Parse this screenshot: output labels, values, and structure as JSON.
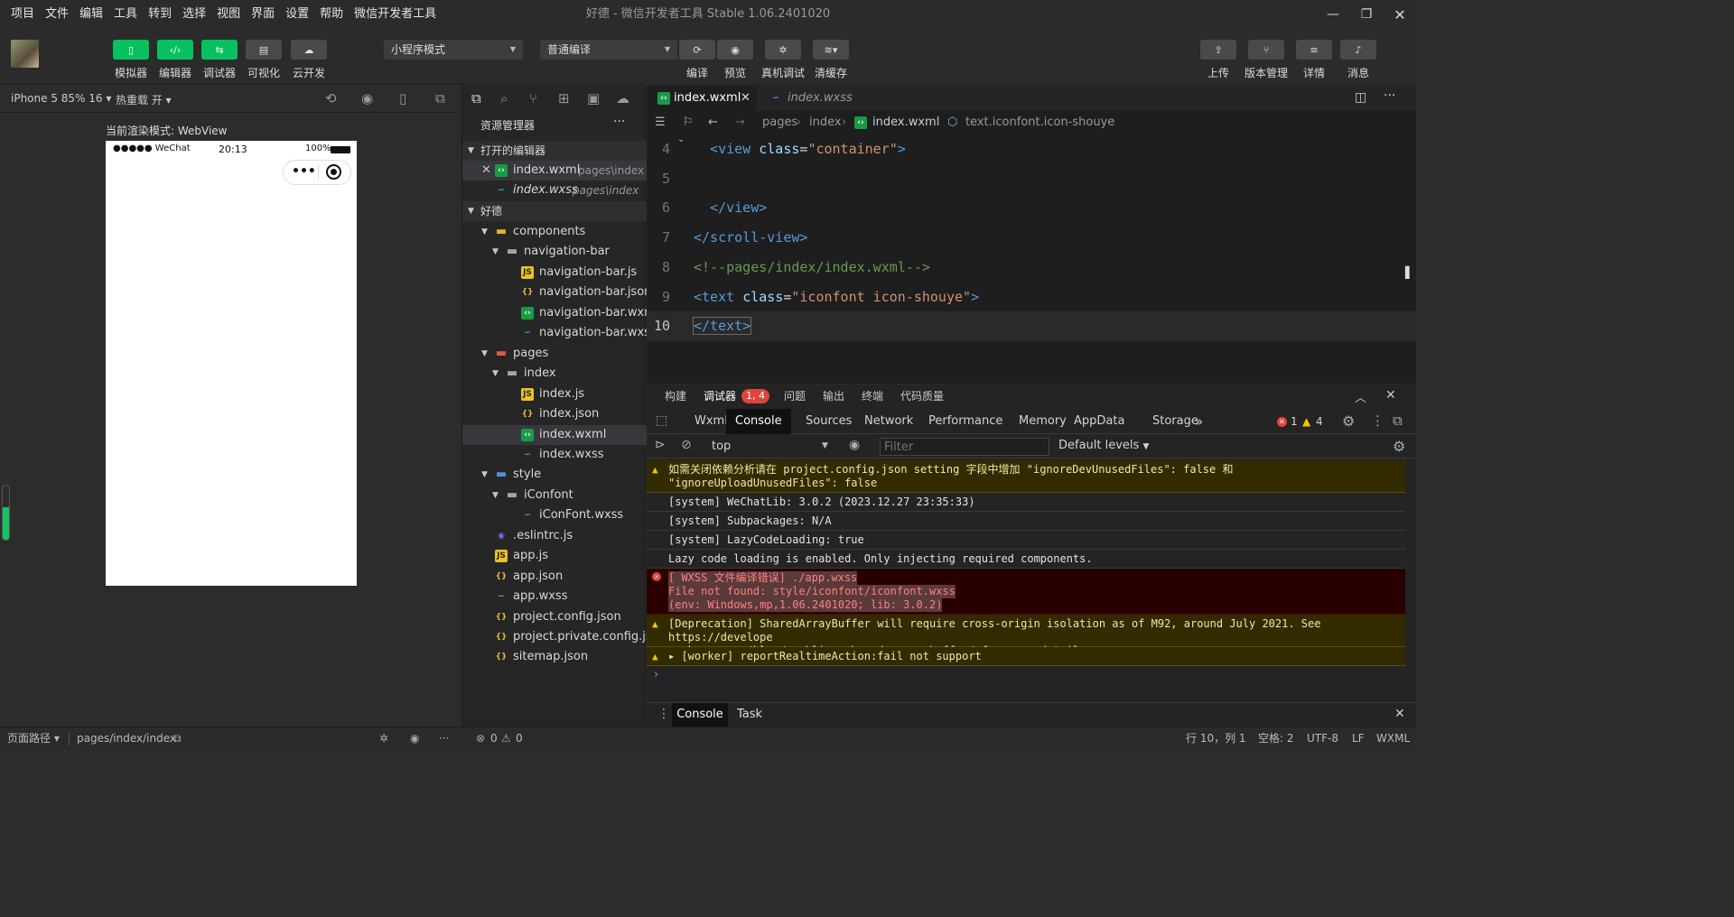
{
  "app": {
    "menu": [
      "项目",
      "文件",
      "编辑",
      "工具",
      "转到",
      "选择",
      "视图",
      "界面",
      "设置",
      "帮助",
      "微信开发者工具"
    ],
    "window_title": "好德 - 微信开发者工具 Stable 1.06.2401020"
  },
  "toolbar": {
    "left_buttons": [
      "模拟器",
      "编辑器",
      "调试器",
      "可视化",
      "云开发"
    ],
    "mode_select": "小程序模式",
    "compile_select": "普通编译",
    "mid_buttons": [
      "编译",
      "预览",
      "真机调试",
      "清缓存"
    ],
    "right_buttons": [
      "上传",
      "版本管理",
      "详情",
      "消息"
    ]
  },
  "simulator": {
    "device": "iPhone 5 85% 16",
    "hot_reload": "热重载 开",
    "render_mode": "当前渲染模式: WebView",
    "status_carrier": "●●●●● WeChat",
    "status_time": "20:13",
    "status_battery": "100%"
  },
  "explorer": {
    "title": "资源管理器",
    "open_editors": "打开的编辑器",
    "open_files": [
      {
        "name": "index.wxml",
        "path": "pages\\index"
      },
      {
        "name": "index.wxss",
        "path": "pages\\index"
      }
    ],
    "project": "好德",
    "tree": [
      {
        "label": "components",
        "depth": 1,
        "kind": "folder-special",
        "open": true
      },
      {
        "label": "navigation-bar",
        "depth": 2,
        "kind": "folder",
        "open": true
      },
      {
        "label": "navigation-bar.js",
        "depth": 3,
        "kind": "js"
      },
      {
        "label": "navigation-bar.json",
        "depth": 3,
        "kind": "json"
      },
      {
        "label": "navigation-bar.wxml",
        "depth": 3,
        "kind": "wxml"
      },
      {
        "label": "navigation-bar.wxss",
        "depth": 3,
        "kind": "wxss"
      },
      {
        "label": "pages",
        "depth": 1,
        "kind": "folder-pages",
        "open": true
      },
      {
        "label": "index",
        "depth": 2,
        "kind": "folder",
        "open": true
      },
      {
        "label": "index.js",
        "depth": 3,
        "kind": "js"
      },
      {
        "label": "index.json",
        "depth": 3,
        "kind": "json"
      },
      {
        "label": "index.wxml",
        "depth": 3,
        "kind": "wxml",
        "selected": true
      },
      {
        "label": "index.wxss",
        "depth": 3,
        "kind": "wxss"
      },
      {
        "label": "style",
        "depth": 1,
        "kind": "folder-style",
        "open": true
      },
      {
        "label": "iConfont",
        "depth": 2,
        "kind": "folder",
        "open": true
      },
      {
        "label": "iConFont.wxss",
        "depth": 3,
        "kind": "wxss"
      },
      {
        "label": ".eslintrc.js",
        "depth": 1,
        "kind": "eslint"
      },
      {
        "label": "app.js",
        "depth": 1,
        "kind": "js"
      },
      {
        "label": "app.json",
        "depth": 1,
        "kind": "json"
      },
      {
        "label": "app.wxss",
        "depth": 1,
        "kind": "wxss"
      },
      {
        "label": "project.config.json",
        "depth": 1,
        "kind": "json"
      },
      {
        "label": "project.private.config.js...",
        "depth": 1,
        "kind": "json"
      },
      {
        "label": "sitemap.json",
        "depth": 1,
        "kind": "json"
      }
    ]
  },
  "editor": {
    "tabs": [
      {
        "label": "index.wxml",
        "active": true
      },
      {
        "label": "index.wxss",
        "active": false
      }
    ],
    "breadcrumb": [
      "pages",
      "index",
      "index.wxml",
      "text.iconfont.icon-shouye"
    ],
    "lines": [
      {
        "n": "4",
        "tokens": [
          [
            "pl",
            "  "
          ],
          [
            "tg",
            "<view "
          ],
          [
            "at",
            "class"
          ],
          [
            "pl",
            "="
          ],
          [
            "st",
            "\"container\""
          ],
          [
            "tg",
            ">"
          ]
        ]
      },
      {
        "n": "5",
        "tokens": []
      },
      {
        "n": "6",
        "tokens": [
          [
            "pl",
            "  "
          ],
          [
            "tg",
            "</view>"
          ]
        ]
      },
      {
        "n": "7",
        "tokens": [
          [
            "tg",
            "</scroll-view>"
          ]
        ]
      },
      {
        "n": "8",
        "tokens": [
          [
            "cm",
            "<!--pages/index/index.wxml-->"
          ]
        ]
      },
      {
        "n": "9",
        "tokens": [
          [
            "tg",
            "<text "
          ],
          [
            "at",
            "class"
          ],
          [
            "pl",
            "="
          ],
          [
            "st",
            "\"iconfont icon-shouye\""
          ],
          [
            "tg",
            ">"
          ]
        ]
      },
      {
        "n": "10",
        "tokens": [
          [
            "tg",
            "</text>"
          ]
        ]
      }
    ]
  },
  "devtools": {
    "top_tabs": [
      "构建",
      "调试器",
      "问题",
      "输出",
      "终端",
      "代码质量"
    ],
    "debugger_badge": "1, 4",
    "tabs": [
      "Wxml",
      "Console",
      "Sources",
      "Network",
      "Performance",
      "Memory",
      "AppData",
      "Storage"
    ],
    "more": "»",
    "error_count": "1",
    "warn_count": "4",
    "context": "top",
    "filter_placeholder": "Filter",
    "levels": "Default levels",
    "console": [
      {
        "level": "warn",
        "lines": [
          "如需关闭依赖分析请在 project.config.json setting 字段中增加 \"ignoreDevUnusedFiles\": false 和",
          "\"ignoreUploadUnusedFiles\": false"
        ]
      },
      {
        "level": "info",
        "lines": [
          "[system] WeChatLib: 3.0.2 (2023.12.27 23:35:33)"
        ]
      },
      {
        "level": "info",
        "lines": [
          "[system] Subpackages: N/A"
        ]
      },
      {
        "level": "info",
        "lines": [
          "[system] LazyCodeLoading: true"
        ]
      },
      {
        "level": "info",
        "lines": [
          "Lazy code loading is enabled. Only injecting required components."
        ]
      },
      {
        "level": "error",
        "lines": [
          "[ WXSS 文件编译错误] ./app.wxss",
          "File not found: style/iconfont/iconfont.wxss",
          "(env: Windows,mp,1.06.2401020; lib: 3.0.2)"
        ]
      },
      {
        "level": "warn",
        "lines": [
          "[Deprecation] SharedArrayBuffer will require cross-origin isolation as of M92, around July 2021. See https://develope",
          "r.chrome.com/blog/enabling-shared-array-buffer/ for more details."
        ]
      },
      {
        "level": "warn",
        "lines": [
          "▸ [worker] reportRealtimeAction:fail not support"
        ]
      }
    ],
    "prompt": "›",
    "bottom_tabs": [
      "Console",
      "Task"
    ]
  },
  "statusbar": {
    "page_path_label": "页面路径",
    "page_path": "pages/index/index",
    "errors": "0",
    "warnings": "0",
    "position": "行 10，列 1",
    "spaces": "空格: 2",
    "encoding": "UTF-8",
    "eol": "LF",
    "language": "WXML"
  }
}
